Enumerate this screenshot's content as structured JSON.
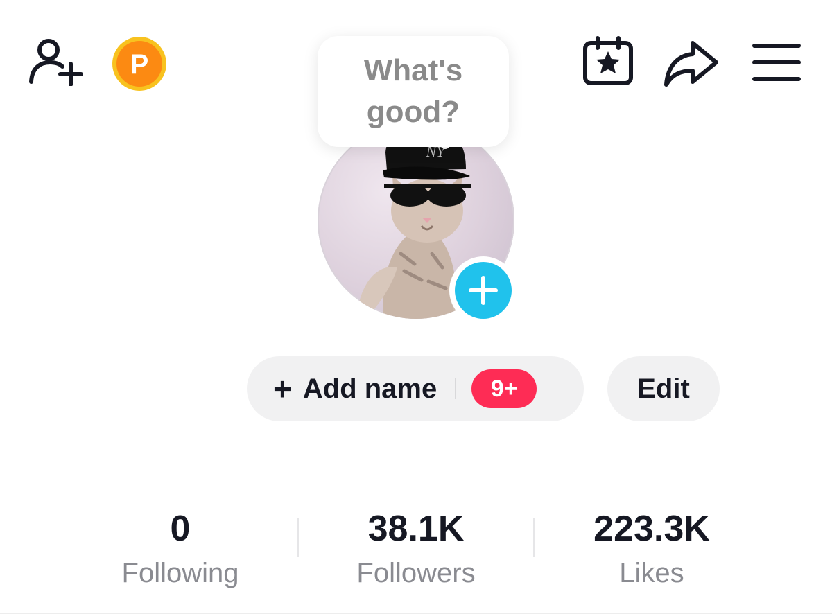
{
  "top_bar": {
    "icons": [
      "add-friend-icon",
      "points-coin-icon",
      "calendar-star-icon",
      "share-icon",
      "menu-icon"
    ],
    "points_letter": "P"
  },
  "bubble": {
    "text": "What's good?"
  },
  "avatar": {
    "cap_logo": "NY",
    "plus_icon": "add-avatar-icon"
  },
  "buttons": {
    "add_name_plus": "+",
    "add_name_label": "Add name",
    "badge": "9+",
    "edit_label": "Edit"
  },
  "stats": [
    {
      "value": "0",
      "label": "Following"
    },
    {
      "value": "38.1K",
      "label": "Followers"
    },
    {
      "value": "223.3K",
      "label": "Likes"
    }
  ],
  "colors": {
    "accent_blue": "#20c2ec",
    "badge_red": "#fe2c55",
    "coin_orange": "#fc8a12",
    "coin_ring": "#f8c21f"
  }
}
